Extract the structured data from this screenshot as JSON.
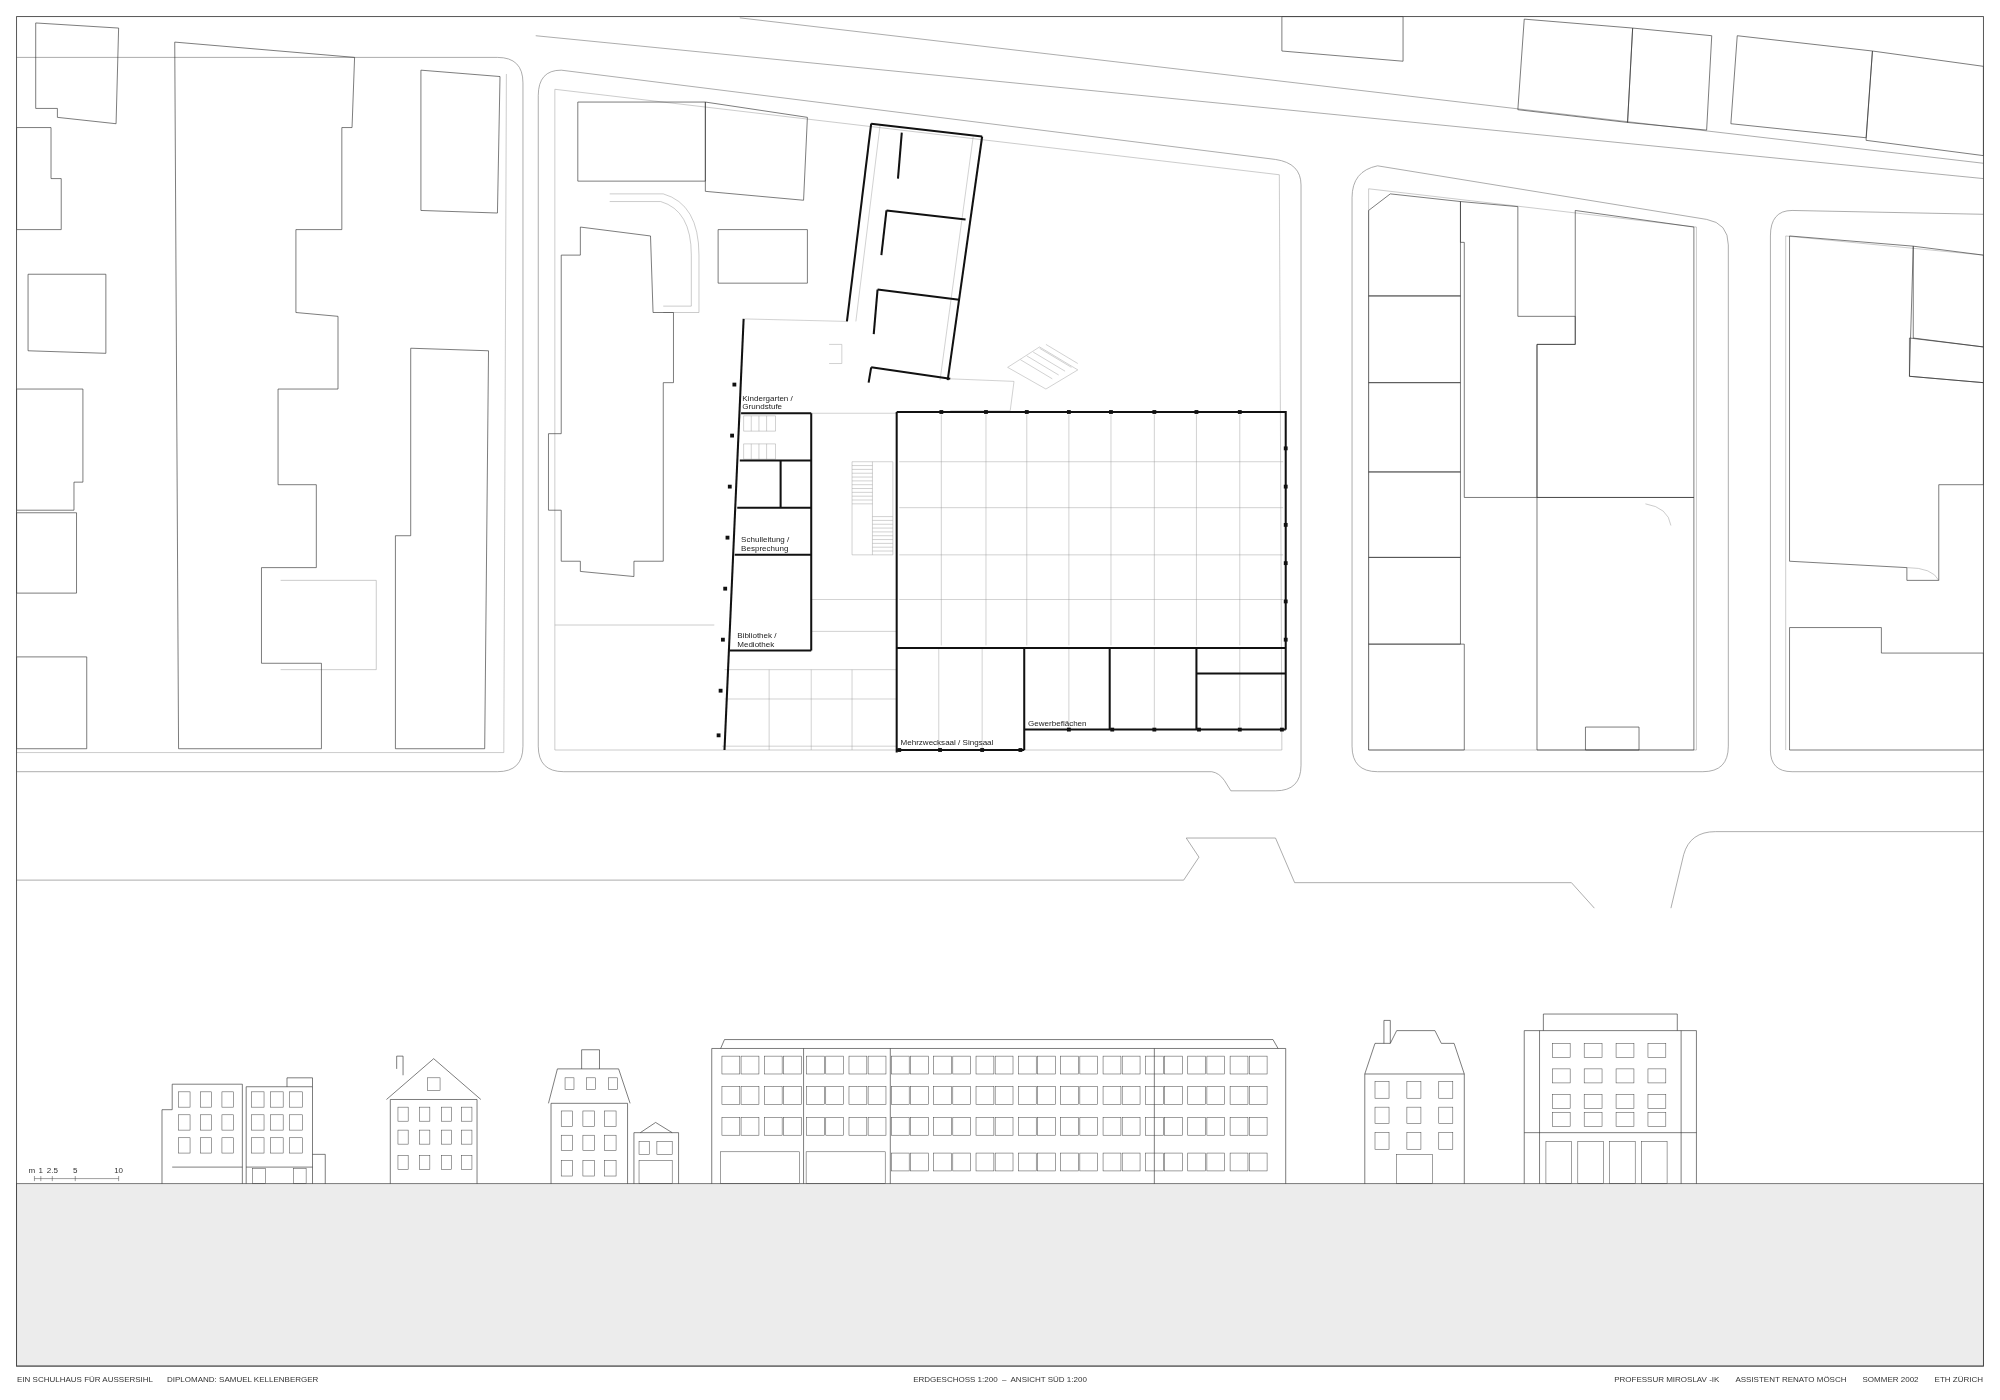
{
  "plan": {
    "room_labels": [
      "Kindergarten / Grundstufe",
      "Schulleitung / Besprechung",
      "Bibliothek / Mediothek",
      "Mehrzwecksaal / Singsaal",
      "Gewerbeflächen"
    ]
  },
  "scale_bar": {
    "labels": [
      "m",
      "1",
      "2.5",
      "5",
      "10"
    ]
  },
  "footer": {
    "project": "EIN SCHULHAUS FÜR AUSSERSIHL",
    "student": "DIPLOMAND: SAMUEL KELLENBERGER",
    "drawing_title": "ERDGESCHOSS 1:200  –  ANSICHT SÜD 1:200",
    "credits": [
      "PROFESSUR MIROSLAV -IK",
      "ASSISTENT RENATO MÖSCH",
      "SOMMER 2002",
      "ETH ZÜRICH"
    ]
  }
}
